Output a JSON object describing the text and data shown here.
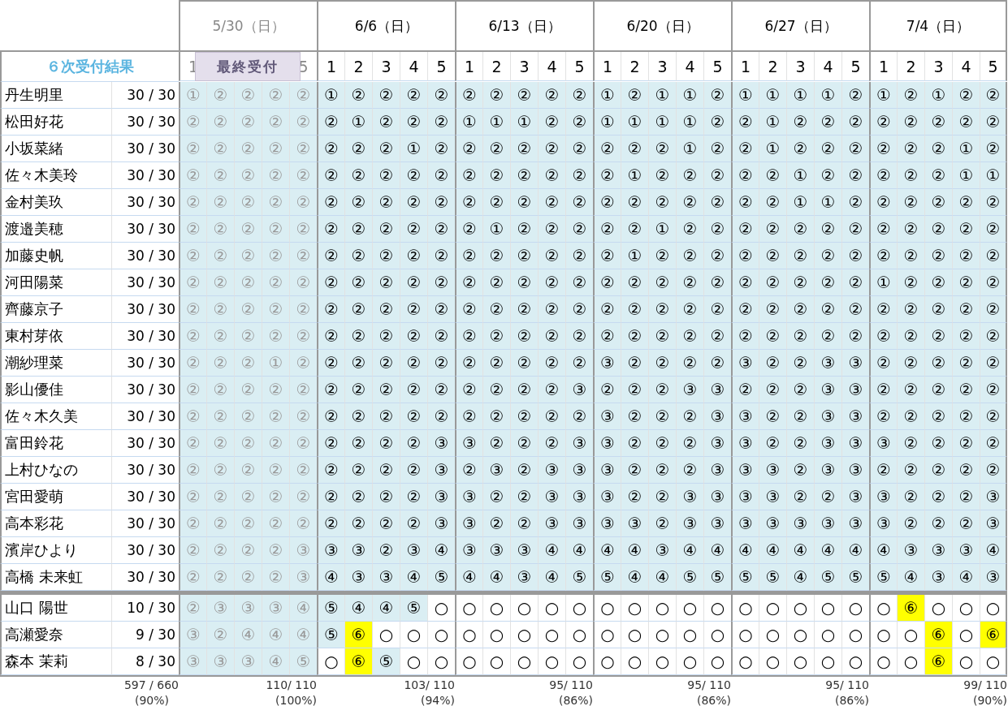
{
  "title": "６次受付結果",
  "deadline_label": "最終受付",
  "summary": {
    "count": "597 / 660",
    "percent": "(90%)"
  },
  "dates": [
    {
      "label": "5/30（日）",
      "closed": true,
      "slots": [
        "1",
        "5"
      ],
      "total": "110/ 110",
      "percent": "(100%)"
    },
    {
      "label": "6/6（日）",
      "closed": false,
      "slots": [
        "1",
        "2",
        "3",
        "4",
        "5"
      ],
      "total": "103/ 110",
      "percent": "(94%)"
    },
    {
      "label": "6/13（日）",
      "closed": false,
      "slots": [
        "1",
        "2",
        "3",
        "4",
        "5"
      ],
      "total": "95/ 110",
      "percent": "(86%)"
    },
    {
      "label": "6/20（日）",
      "closed": false,
      "slots": [
        "1",
        "2",
        "3",
        "4",
        "5"
      ],
      "total": "95/ 110",
      "percent": "(86%)"
    },
    {
      "label": "6/27（日）",
      "closed": false,
      "slots": [
        "1",
        "2",
        "3",
        "4",
        "5"
      ],
      "total": "95/ 110",
      "percent": "(86%)"
    },
    {
      "label": "7/4（日）",
      "closed": false,
      "slots": [
        "1",
        "2",
        "3",
        "4",
        "5"
      ],
      "total": "99/ 110",
      "percent": "(90%)"
    }
  ],
  "sections": [
    {
      "rows": [
        {
          "name": "丹生明里",
          "count": "30 / 30",
          "cells": [
            "①",
            "②",
            "②",
            "②",
            "②",
            "①",
            "②",
            "②",
            "②",
            "②",
            "②",
            "②",
            "②",
            "②",
            "②",
            "①",
            "②",
            "①",
            "①",
            "②",
            "①",
            "①",
            "①",
            "①",
            "②",
            "①",
            "②",
            "①",
            "②",
            "②"
          ]
        },
        {
          "name": "松田好花",
          "count": "30 / 30",
          "cells": [
            "②",
            "②",
            "②",
            "②",
            "②",
            "②",
            "①",
            "②",
            "②",
            "②",
            "①",
            "①",
            "①",
            "②",
            "②",
            "①",
            "①",
            "①",
            "①",
            "②",
            "②",
            "①",
            "②",
            "②",
            "②",
            "②",
            "②",
            "②",
            "②",
            "②"
          ]
        },
        {
          "name": "小坂菜緒",
          "count": "30 / 30",
          "cells": [
            "②",
            "②",
            "②",
            "②",
            "②",
            "②",
            "②",
            "②",
            "①",
            "②",
            "②",
            "②",
            "②",
            "②",
            "②",
            "②",
            "②",
            "②",
            "①",
            "②",
            "②",
            "①",
            "②",
            "②",
            "②",
            "②",
            "②",
            "②",
            "①",
            "②"
          ]
        },
        {
          "name": "佐々木美玲",
          "count": "30 / 30",
          "cells": [
            "②",
            "②",
            "②",
            "②",
            "②",
            "②",
            "②",
            "②",
            "②",
            "②",
            "②",
            "②",
            "②",
            "②",
            "②",
            "②",
            "①",
            "②",
            "②",
            "②",
            "②",
            "②",
            "①",
            "②",
            "②",
            "②",
            "②",
            "②",
            "①",
            "①"
          ]
        },
        {
          "name": "金村美玖",
          "count": "30 / 30",
          "cells": [
            "②",
            "②",
            "②",
            "②",
            "②",
            "②",
            "②",
            "②",
            "②",
            "②",
            "②",
            "②",
            "②",
            "②",
            "②",
            "②",
            "②",
            "②",
            "②",
            "②",
            "②",
            "②",
            "①",
            "①",
            "②",
            "②",
            "②",
            "②",
            "②",
            "②"
          ]
        },
        {
          "name": "渡邉美穂",
          "count": "30 / 30",
          "cells": [
            "②",
            "②",
            "②",
            "②",
            "②",
            "②",
            "②",
            "②",
            "②",
            "②",
            "②",
            "①",
            "②",
            "②",
            "②",
            "②",
            "②",
            "①",
            "②",
            "②",
            "②",
            "②",
            "②",
            "②",
            "②",
            "②",
            "②",
            "②",
            "②",
            "②"
          ]
        },
        {
          "name": "加藤史帆",
          "count": "30 / 30",
          "cells": [
            "②",
            "②",
            "②",
            "②",
            "②",
            "②",
            "②",
            "②",
            "②",
            "②",
            "②",
            "②",
            "②",
            "②",
            "②",
            "②",
            "①",
            "②",
            "②",
            "②",
            "②",
            "②",
            "②",
            "②",
            "②",
            "②",
            "②",
            "②",
            "②",
            "②"
          ]
        },
        {
          "name": "河田陽菜",
          "count": "30 / 30",
          "cells": [
            "②",
            "②",
            "②",
            "②",
            "②",
            "②",
            "②",
            "②",
            "②",
            "②",
            "②",
            "②",
            "②",
            "②",
            "②",
            "②",
            "②",
            "②",
            "②",
            "②",
            "②",
            "②",
            "②",
            "②",
            "②",
            "①",
            "②",
            "②",
            "②",
            "②"
          ]
        },
        {
          "name": "齊藤京子",
          "count": "30 / 30",
          "cells": [
            "②",
            "②",
            "②",
            "②",
            "②",
            "②",
            "②",
            "②",
            "②",
            "②",
            "②",
            "②",
            "②",
            "②",
            "②",
            "②",
            "②",
            "②",
            "②",
            "②",
            "②",
            "②",
            "②",
            "②",
            "②",
            "②",
            "②",
            "②",
            "②",
            "②"
          ]
        },
        {
          "name": "東村芽依",
          "count": "30 / 30",
          "cells": [
            "②",
            "②",
            "②",
            "②",
            "②",
            "②",
            "②",
            "②",
            "②",
            "②",
            "②",
            "②",
            "②",
            "②",
            "②",
            "②",
            "②",
            "②",
            "②",
            "②",
            "②",
            "②",
            "②",
            "②",
            "②",
            "②",
            "②",
            "②",
            "②",
            "②"
          ]
        },
        {
          "name": "潮紗理菜",
          "count": "30 / 30",
          "cells": [
            "②",
            "②",
            "②",
            "①",
            "②",
            "②",
            "②",
            "②",
            "②",
            "②",
            "②",
            "②",
            "②",
            "②",
            "②",
            "③",
            "②",
            "②",
            "②",
            "②",
            "③",
            "②",
            "②",
            "③",
            "③",
            "②",
            "②",
            "②",
            "②",
            "②"
          ]
        },
        {
          "name": "影山優佳",
          "count": "30 / 30",
          "cells": [
            "②",
            "②",
            "②",
            "②",
            "②",
            "②",
            "②",
            "②",
            "②",
            "②",
            "②",
            "②",
            "②",
            "②",
            "③",
            "②",
            "②",
            "②",
            "③",
            "③",
            "②",
            "②",
            "②",
            "③",
            "③",
            "②",
            "②",
            "②",
            "②",
            "②"
          ]
        },
        {
          "name": "佐々木久美",
          "count": "30 / 30",
          "cells": [
            "②",
            "②",
            "②",
            "②",
            "②",
            "②",
            "②",
            "②",
            "②",
            "②",
            "②",
            "②",
            "②",
            "②",
            "②",
            "③",
            "②",
            "②",
            "②",
            "③",
            "③",
            "②",
            "②",
            "③",
            "③",
            "②",
            "②",
            "②",
            "②",
            "②"
          ]
        },
        {
          "name": "富田鈴花",
          "count": "30 / 30",
          "cells": [
            "②",
            "②",
            "②",
            "②",
            "②",
            "②",
            "②",
            "②",
            "②",
            "③",
            "③",
            "②",
            "②",
            "②",
            "③",
            "③",
            "②",
            "②",
            "②",
            "③",
            "③",
            "②",
            "②",
            "③",
            "③",
            "③",
            "②",
            "②",
            "②",
            "②"
          ]
        },
        {
          "name": "上村ひなの",
          "count": "30 / 30",
          "cells": [
            "②",
            "②",
            "②",
            "②",
            "②",
            "②",
            "②",
            "②",
            "②",
            "③",
            "②",
            "③",
            "②",
            "③",
            "③",
            "③",
            "②",
            "②",
            "②",
            "③",
            "③",
            "③",
            "②",
            "③",
            "③",
            "②",
            "②",
            "②",
            "②",
            "②"
          ]
        },
        {
          "name": "宮田愛萌",
          "count": "30 / 30",
          "cells": [
            "②",
            "②",
            "②",
            "②",
            "②",
            "②",
            "②",
            "②",
            "②",
            "③",
            "③",
            "②",
            "②",
            "③",
            "③",
            "③",
            "②",
            "②",
            "③",
            "③",
            "③",
            "③",
            "②",
            "②",
            "③",
            "③",
            "②",
            "②",
            "②",
            "③"
          ]
        },
        {
          "name": "高本彩花",
          "count": "30 / 30",
          "cells": [
            "②",
            "②",
            "②",
            "②",
            "②",
            "②",
            "②",
            "②",
            "②",
            "③",
            "③",
            "②",
            "②",
            "③",
            "③",
            "③",
            "③",
            "②",
            "③",
            "③",
            "③",
            "③",
            "③",
            "③",
            "③",
            "③",
            "②",
            "②",
            "②",
            "③"
          ]
        },
        {
          "name": "濱岸ひより",
          "count": "30 / 30",
          "cells": [
            "②",
            "②",
            "②",
            "②",
            "③",
            "③",
            "③",
            "②",
            "③",
            "④",
            "③",
            "③",
            "③",
            "④",
            "④",
            "④",
            "④",
            "③",
            "④",
            "④",
            "④",
            "④",
            "④",
            "④",
            "④",
            "④",
            "③",
            "③",
            "③",
            "④"
          ]
        },
        {
          "name": "高橋 未来虹",
          "count": "30 / 30",
          "cells": [
            "②",
            "②",
            "②",
            "②",
            "③",
            "④",
            "③",
            "③",
            "④",
            "⑤",
            "④",
            "④",
            "③",
            "④",
            "⑤",
            "⑤",
            "④",
            "④",
            "⑤",
            "⑤",
            "⑤",
            "⑤",
            "④",
            "⑤",
            "⑤",
            "⑤",
            "④",
            "③",
            "④",
            "③"
          ]
        }
      ]
    },
    {
      "rows": [
        {
          "name": "山口 陽世",
          "count": "10 / 30",
          "cells": [
            "②",
            "③",
            "③",
            "③",
            "④",
            "⑤",
            "④",
            "④",
            "⑤",
            "○",
            "○",
            "○",
            "○",
            "○",
            "○",
            "○",
            "○",
            "○",
            "○",
            "○",
            "○",
            "○",
            "○",
            "○",
            "○",
            "○",
            "⑥",
            "○",
            "○",
            "○"
          ],
          "shaded": [
            true,
            true,
            true,
            true,
            true,
            true,
            true,
            true,
            true,
            false,
            false,
            false,
            false,
            false,
            false,
            false,
            false,
            false,
            false,
            false,
            false,
            false,
            false,
            false,
            false,
            false,
            false,
            false,
            false,
            false
          ],
          "highlighted": [
            false,
            false,
            false,
            false,
            false,
            false,
            false,
            false,
            false,
            false,
            false,
            false,
            false,
            false,
            false,
            false,
            false,
            false,
            false,
            false,
            false,
            false,
            false,
            false,
            false,
            false,
            true,
            false,
            false,
            false
          ]
        },
        {
          "name": "高瀬愛奈",
          "count": "9 / 30",
          "cells": [
            "③",
            "②",
            "④",
            "④",
            "④",
            "⑤",
            "⑥",
            "○",
            "○",
            "○",
            "○",
            "○",
            "○",
            "○",
            "○",
            "○",
            "○",
            "○",
            "○",
            "○",
            "○",
            "○",
            "○",
            "○",
            "○",
            "○",
            "○",
            "⑥",
            "○",
            "⑥"
          ],
          "shaded": [
            true,
            true,
            true,
            true,
            true,
            true,
            false,
            false,
            false,
            false,
            false,
            false,
            false,
            false,
            false,
            false,
            false,
            false,
            false,
            false,
            false,
            false,
            false,
            false,
            false,
            false,
            false,
            false,
            false,
            false
          ],
          "highlighted": [
            false,
            false,
            false,
            false,
            false,
            false,
            true,
            false,
            false,
            false,
            false,
            false,
            false,
            false,
            false,
            false,
            false,
            false,
            false,
            false,
            false,
            false,
            false,
            false,
            false,
            false,
            false,
            true,
            false,
            true
          ]
        },
        {
          "name": "森本 茉莉",
          "count": "8 / 30",
          "cells": [
            "③",
            "③",
            "③",
            "④",
            "⑤",
            "○",
            "⑥",
            "⑤",
            "○",
            "○",
            "○",
            "○",
            "○",
            "○",
            "○",
            "○",
            "○",
            "○",
            "○",
            "○",
            "○",
            "○",
            "○",
            "○",
            "○",
            "○",
            "○",
            "⑥",
            "○",
            "○"
          ],
          "shaded": [
            true,
            true,
            true,
            true,
            true,
            false,
            false,
            true,
            false,
            false,
            false,
            false,
            false,
            false,
            false,
            false,
            false,
            false,
            false,
            false,
            false,
            false,
            false,
            false,
            false,
            false,
            false,
            false,
            false,
            false
          ],
          "highlighted": [
            false,
            false,
            false,
            false,
            false,
            false,
            true,
            false,
            false,
            false,
            false,
            false,
            false,
            false,
            false,
            false,
            false,
            false,
            false,
            false,
            false,
            false,
            false,
            false,
            false,
            false,
            false,
            true,
            false,
            false
          ]
        }
      ]
    }
  ]
}
